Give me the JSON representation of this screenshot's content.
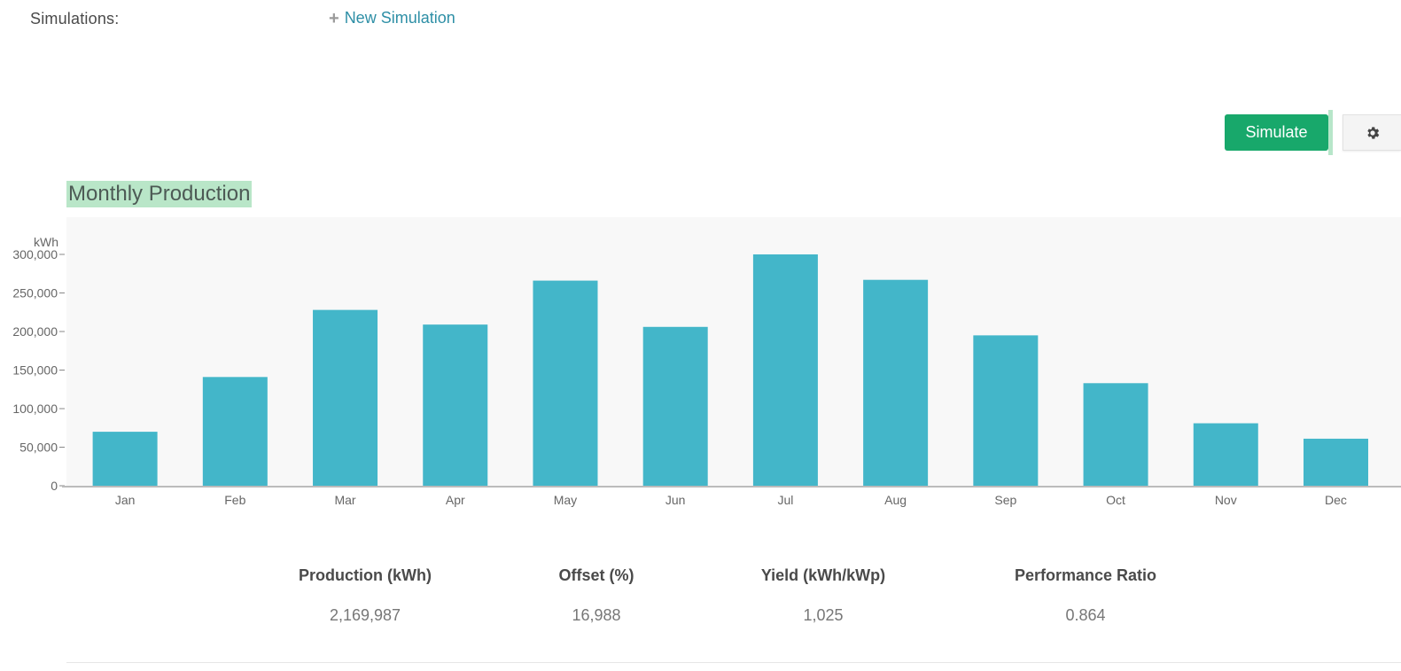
{
  "header": {
    "simulations_label": "Simulations:",
    "new_simulation_label": "New Simulation"
  },
  "toolbar": {
    "simulate_label": "Simulate",
    "settings_icon": "gear-icon"
  },
  "chart_title": "Monthly Production",
  "chart_data": {
    "type": "bar",
    "title": "Monthly Production",
    "ylabel": "kWh",
    "xlabel": "",
    "categories": [
      "Jan",
      "Feb",
      "Mar",
      "Apr",
      "May",
      "Jun",
      "Jul",
      "Aug",
      "Sep",
      "Oct",
      "Nov",
      "Dec"
    ],
    "values": [
      70000,
      141000,
      228000,
      209000,
      266000,
      206000,
      300000,
      267000,
      195000,
      133000,
      81000,
      61000
    ],
    "ylim": [
      0,
      300000
    ],
    "yticks": [
      0,
      50000,
      100000,
      150000,
      200000,
      250000,
      300000
    ],
    "ytick_labels": [
      "0",
      "50,000",
      "100,000",
      "150,000",
      "200,000",
      "250,000",
      "300,000"
    ],
    "bar_color": "#43b6c9",
    "background_color": "#f8f8f8",
    "grid": false
  },
  "summary": {
    "columns": [
      {
        "label": "Production (kWh)",
        "value": "2,169,987"
      },
      {
        "label": "Offset (%)",
        "value": "16,988"
      },
      {
        "label": "Yield (kWh/kWp)",
        "value": "1,025"
      },
      {
        "label": "Performance Ratio",
        "value": "0.864"
      }
    ]
  },
  "colors": {
    "accent": "#18a86b",
    "link": "#2e8fa6",
    "title_highlight": "#b9e6c8"
  }
}
